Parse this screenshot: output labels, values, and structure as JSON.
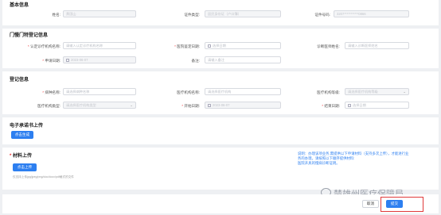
{
  "basic": {
    "title": "基本信息",
    "name_label": "姓名:",
    "name_value": "黄国山",
    "idtype_label": "证件类型:",
    "idtype_value": "居民身份证（户口簿）",
    "idno_label": "证件号码:",
    "idno_value": "3207***********0866"
  },
  "outpatient": {
    "title": "门慢门特登记信息",
    "disease_label": "认定诊疗机构名称:",
    "disease_placeholder": "请输入认定诊疗机构名称",
    "diag_date_label": "医院鉴定日期:",
    "diag_date_placeholder": "选择日期",
    "doctor_label": "诊断医师姓名:",
    "doctor_placeholder": "请输入诊断医师姓名",
    "apply_date_label": "申请日期:",
    "apply_date_value": "2023-06-07",
    "remark_label": "备注:",
    "remark_placeholder": "请输入备注"
  },
  "register": {
    "title": "登记信息",
    "disease_code_label": "病种名称:",
    "disease_code_placeholder": "请选择病种名称",
    "org_name_label": "医疗机构名称:",
    "org_name_placeholder": "请选择医疗机构",
    "org_level_label": "医疗机构等级:",
    "org_level_placeholder": "请选择医疗机构等级",
    "org_type_label": "医疗机构类型:",
    "org_type_placeholder": "请选择医疗机构类型",
    "start_date_label": "开始日期:",
    "start_date_value": "2023-06-07",
    "end_date_label": "结束日期:",
    "end_date_placeholder": "选择日期"
  },
  "esign": {
    "title": "电子承诺书上传",
    "button": "点击生成"
  },
  "materials": {
    "title": "材料上传",
    "button": "点击上传",
    "hint": "仅支持上传jpg/jpeg/png/doc/docx/pdf格式的文件",
    "note_line1": "说明：办理该项业务,需提供以下申请材料（支持多次上传），才能进行业",
    "note_line2": "务的办理。请按照以下顺序提供材料:",
    "note_line3": "医院开具的慢病诊断证明。"
  },
  "footer": {
    "cancel": "取消",
    "submit": "提交"
  },
  "watermark": {
    "text": "楚雄州医疗保障局"
  },
  "colors": {
    "accent": "#2d7ff0",
    "highlight": "#e03a3a"
  }
}
